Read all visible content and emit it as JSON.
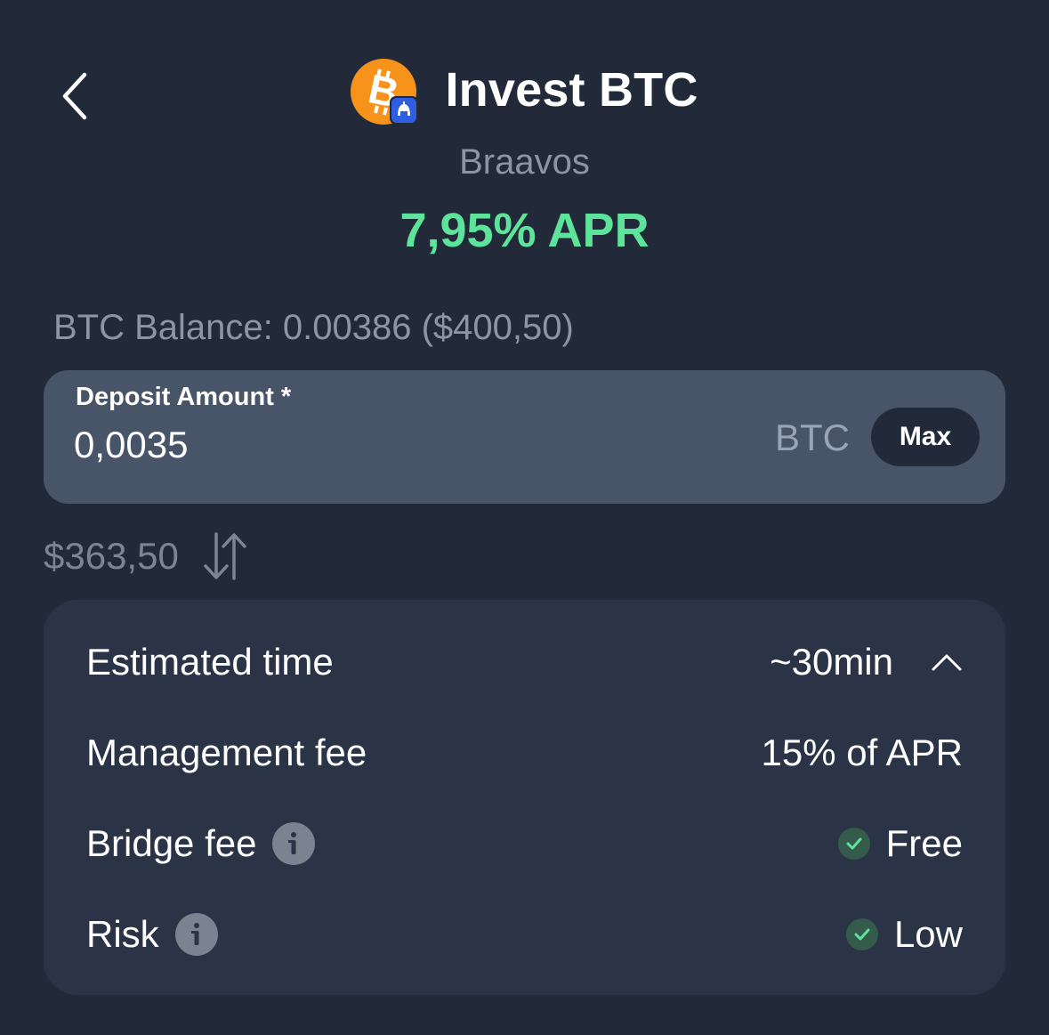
{
  "header": {
    "title": "Invest BTC",
    "subtitle": "Braavos",
    "apr": "7,95% APR",
    "coin_icon": "bitcoin-icon",
    "badge_icon": "braavos-helmet-icon"
  },
  "balance": {
    "text": "BTC Balance: 0.00386 ($400,50)"
  },
  "deposit": {
    "label": "Deposit Amount *",
    "value": "0,0035",
    "unit": "BTC",
    "max_label": "Max"
  },
  "usd_equivalent": "$363,50",
  "details": {
    "rows": [
      {
        "label": "Estimated time",
        "value": "~30min"
      },
      {
        "label": "Management fee",
        "value": "15% of APR"
      },
      {
        "label": "Bridge fee",
        "value": "Free"
      },
      {
        "label": "Risk",
        "value": "Low"
      }
    ]
  },
  "colors": {
    "background": "#222a3a",
    "card": "#2b3446",
    "input": "#485569",
    "apr_green": "#5de39a",
    "muted": "#8d95a3",
    "bitcoin_orange": "#f7931a",
    "badge_blue": "#2f5fe0"
  }
}
